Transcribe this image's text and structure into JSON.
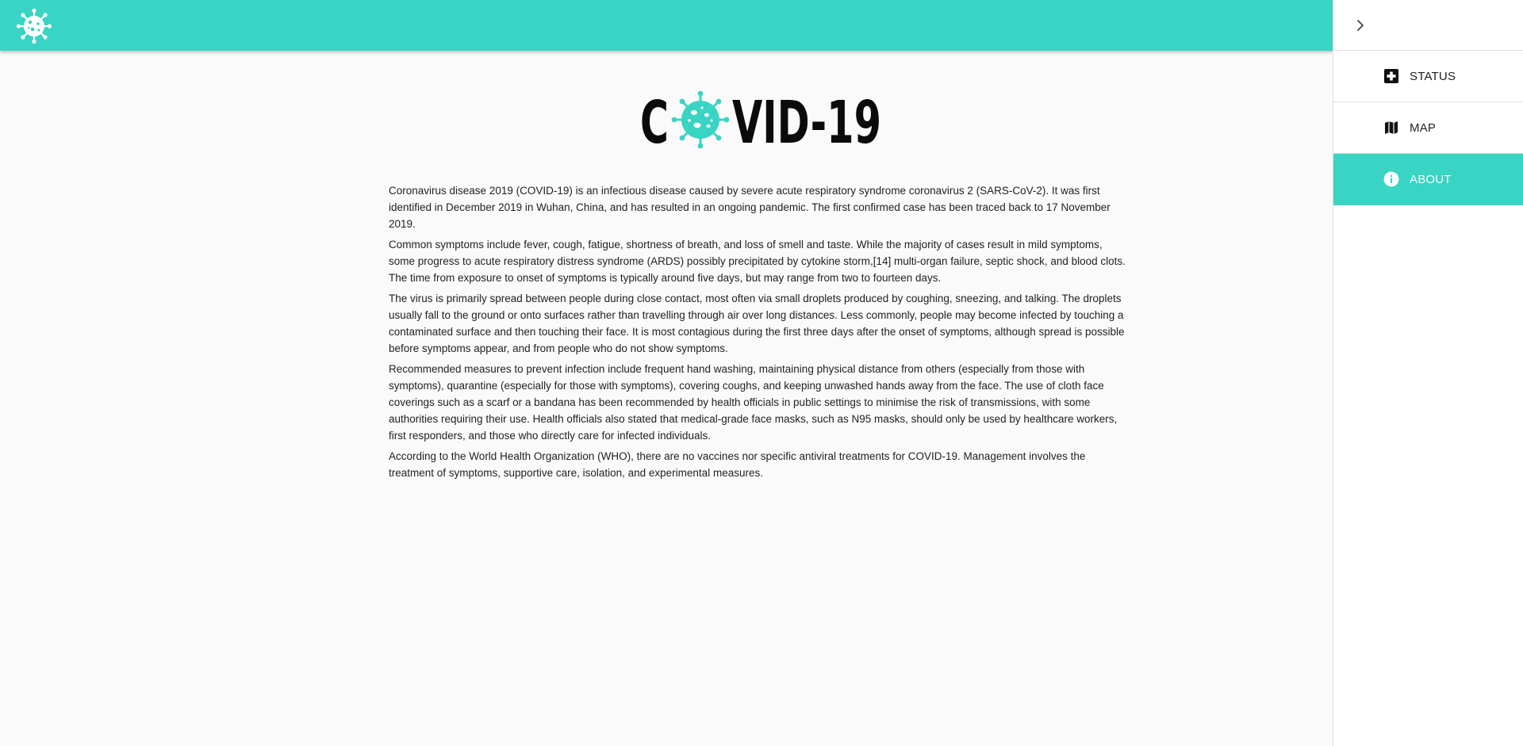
{
  "app": {
    "logo_icon": "virus-icon",
    "accent_color": "#39d4c3"
  },
  "drawer": {
    "collapse_icon": "chevron-right-icon",
    "items": [
      {
        "label": "STATUS",
        "icon": "medical-cross-icon",
        "active": false
      },
      {
        "label": "MAP",
        "icon": "map-icon",
        "active": false
      },
      {
        "label": "ABOUT",
        "icon": "info-icon",
        "active": true
      }
    ]
  },
  "main": {
    "title_part1": "C",
    "title_part2": "VID-19",
    "title_o_icon": "virus-icon",
    "paragraphs": [
      "Coronavirus disease 2019 (COVID-19) is an infectious disease caused by severe acute respiratory syndrome coronavirus 2 (SARS-CoV-2). It was first identified in December 2019 in Wuhan, China, and has resulted in an ongoing pandemic. The first confirmed case has been traced back to 17 November 2019.",
      "Common symptoms include fever, cough, fatigue, shortness of breath, and loss of smell and taste. While the majority of cases result in mild symptoms, some progress to acute respiratory distress syndrome (ARDS) possibly precipitated by cytokine storm,[14] multi-organ failure, septic shock, and blood clots. The time from exposure to onset of symptoms is typically around five days, but may range from two to fourteen days.",
      "The virus is primarily spread between people during close contact, most often via small droplets produced by coughing, sneezing, and talking. The droplets usually fall to the ground or onto surfaces rather than travelling through air over long distances. Less commonly, people may become infected by touching a contaminated surface and then touching their face. It is most contagious during the first three days after the onset of symptoms, although spread is possible before symptoms appear, and from people who do not show symptoms.",
      "Recommended measures to prevent infection include frequent hand washing, maintaining physical distance from others (especially from those with symptoms), quarantine (especially for those with symptoms), covering coughs, and keeping unwashed hands away from the face. The use of cloth face coverings such as a scarf or a bandana has been recommended by health officials in public settings to minimise the risk of transmissions, with some authorities requiring their use. Health officials also stated that medical-grade face masks, such as N95 masks, should only be used by healthcare workers, first responders, and those who directly care for infected individuals.",
      "According to the World Health Organization (WHO), there are no vaccines nor specific antiviral treatments for COVID-19. Management involves the treatment of symptoms, supportive care, isolation, and experimental measures."
    ]
  }
}
